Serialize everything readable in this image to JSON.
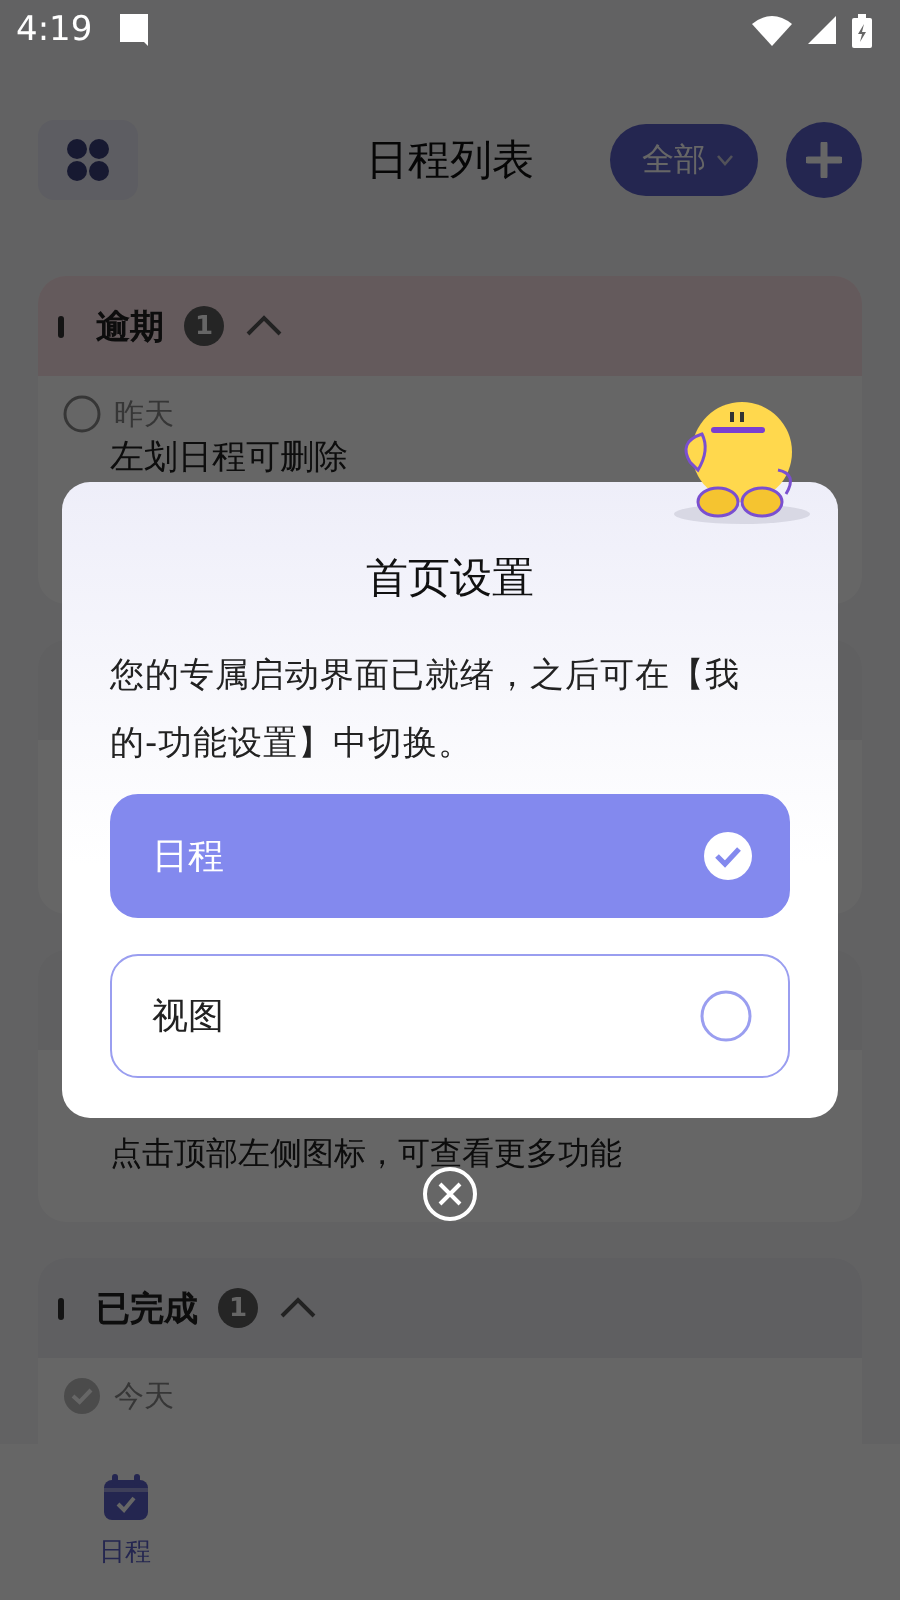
{
  "status_bar": {
    "time": "4:19"
  },
  "header": {
    "title": "日程列表",
    "filter": "全部"
  },
  "sections": [
    {
      "title": "逾期",
      "count": "1",
      "expanded": true,
      "color": "#645a5c",
      "items": [
        {
          "date": "昨天",
          "title": "左划日程可删除",
          "done": false
        }
      ]
    },
    {
      "title": "已完成",
      "count": "1",
      "expanded": true,
      "color": "#5f5f61",
      "items": [
        {
          "date": "今天",
          "done": true
        }
      ]
    }
  ],
  "partially_hidden_item": {
    "title": "点击顶部左侧图标，可查看更多功能"
  },
  "bottom_nav": [
    {
      "label": "日程",
      "selected": true
    }
  ],
  "dialog": {
    "title": "首页设置",
    "message": "您的专属启动界面已就绪，之后可在【我的-功能设置】中切换。",
    "options": [
      {
        "label": "日程",
        "selected": true
      },
      {
        "label": "视图",
        "selected": false
      }
    ]
  }
}
